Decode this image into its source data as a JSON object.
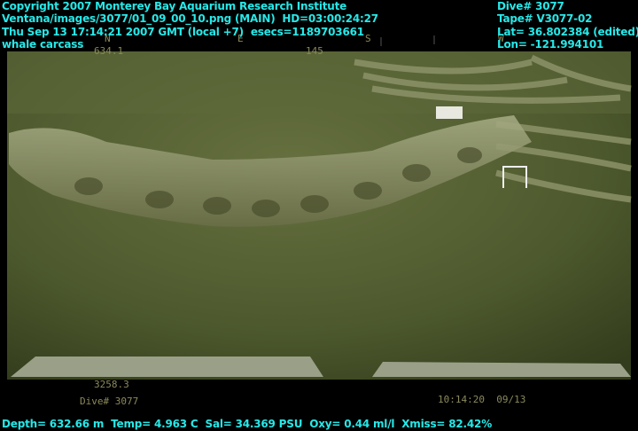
{
  "header_left": {
    "copyright": "Copyright 2007 Monterey Bay Aquarium Research Institute",
    "image_path": "Ventana/images/3077/01_09_00_10.png (MAIN)  HD=03:00:24:27",
    "timestamp": "Thu Sep 13 17:14:21 2007 GMT (local +7)  esecs=1189703661",
    "subject": "whale carcass"
  },
  "header_right": {
    "dive": "Dive# 3077",
    "tape": "Tape# V3077-02",
    "lat": "Lat= 36.802384 (edited)",
    "lon": "Lon= -121.994101"
  },
  "video_burn_in": {
    "compass_n": "N",
    "compass_e": "E",
    "compass_s": "S",
    "compass_w": "W",
    "depth_readout": "634.1",
    "heading_readout": "145",
    "altitude_readout": "3258.3",
    "dive_label": "Dive# 3077",
    "clock": "10:14:20  09/13"
  },
  "footer": {
    "ctd": "Depth= 632.66 m  Temp= 4.963 C  Sal= 34.369 PSU  Oxy= 0.44 ml/l  Xmiss= 82.42%"
  },
  "colors": {
    "overlay_text": "#27e8e8",
    "water": "#4f5a2e"
  }
}
